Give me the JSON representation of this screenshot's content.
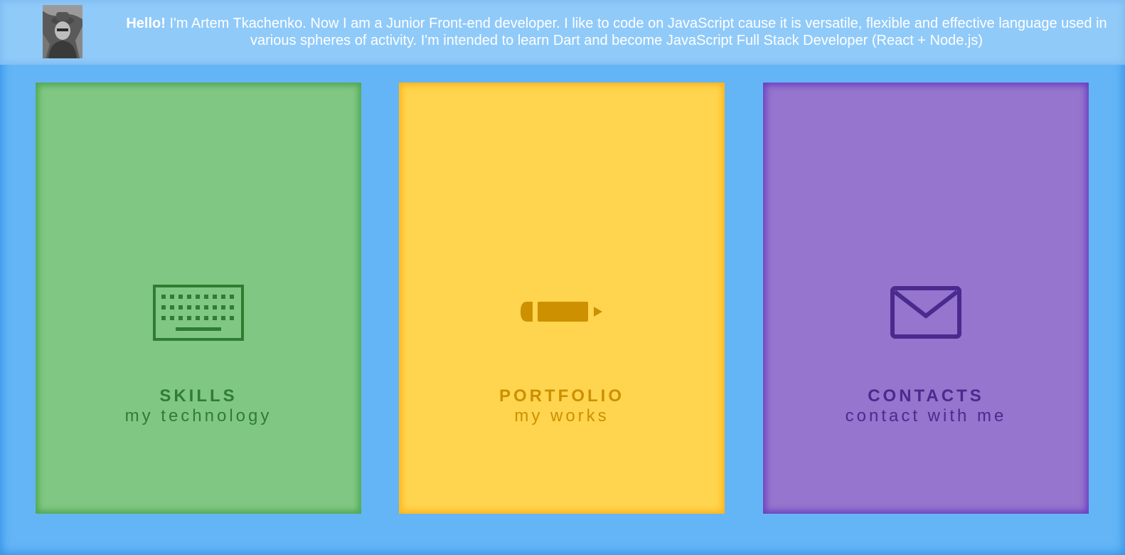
{
  "header": {
    "greeting": "Hello!",
    "intro": " I'm Artem Tkachenko. Now I am a Junior Front-end developer. I like to code on JavaScript cause it is versatile, flexible and effective language used in various spheres of activity. I'm intended to learn Dart and become JavaScript Full Stack Developer (React + Node.js)"
  },
  "cards": [
    {
      "title": "SKILLS",
      "subtitle": "my technology",
      "icon": "keyboard-icon",
      "color": "#81c784",
      "accent": "#2e7d32"
    },
    {
      "title": "PORTFOLIO",
      "subtitle": "my works",
      "icon": "pencil-icon",
      "color": "#ffd54f",
      "accent": "#cc9000"
    },
    {
      "title": "CONTACTS",
      "subtitle": "contact with me",
      "icon": "mail-icon",
      "color": "#9575cd",
      "accent": "#4a2a8e"
    }
  ],
  "colors": {
    "background": "#64b5f6",
    "header": "#90caf9"
  }
}
